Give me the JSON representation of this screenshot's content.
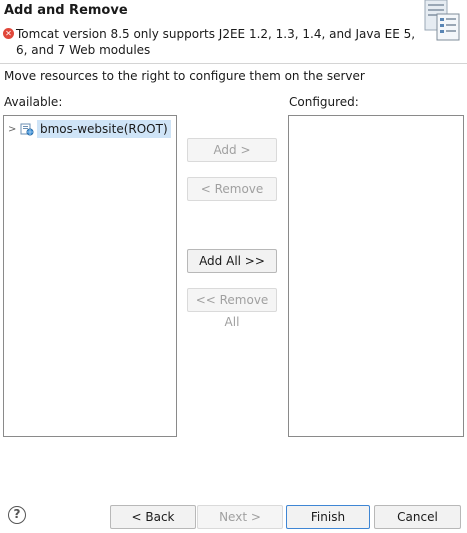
{
  "header": {
    "title": "Add and Remove",
    "message": "Tomcat version 8.5 only supports J2EE 1.2, 1.3, 1.4, and Java EE 5, 6, and 7 Web modules",
    "error_icon": "error-x-icon",
    "banner_icon": "server-banner-icon"
  },
  "instruction": "Move resources to the right to configure them on the server",
  "available": {
    "label": "Available:",
    "items": [
      {
        "label": "bmos-website(ROOT)",
        "chevron": ">",
        "icon": "web-module-icon",
        "selected": true
      }
    ]
  },
  "configured": {
    "label": "Configured:",
    "items": []
  },
  "buttons": {
    "add": "Add >",
    "remove": "< Remove",
    "add_all": "Add All >>",
    "remove_all": "<< Remove All"
  },
  "footer": {
    "help": "?",
    "back": "< Back",
    "next": "Next >",
    "finish": "Finish",
    "cancel": "Cancel"
  },
  "colors": {
    "error": "#e0473a",
    "selection": "#cfe4f7",
    "focus_border": "#3f86d4"
  }
}
